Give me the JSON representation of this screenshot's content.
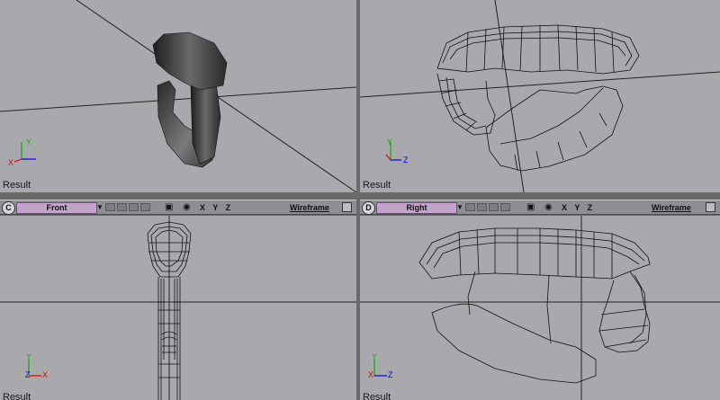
{
  "viewports": {
    "top_left": {
      "label": "Result"
    },
    "top_right": {
      "label": "Result"
    },
    "bottom_left": {
      "badge": "C",
      "view": "Front",
      "axes": "X Y Z",
      "mode": "Wireframe",
      "label": "Result"
    },
    "bottom_right": {
      "badge": "D",
      "view": "Right",
      "axes": "X Y Z",
      "mode": "Wireframe",
      "label": "Result"
    }
  },
  "gizmo": {
    "x_label": "X",
    "y_label": "Y",
    "z_label": "Z",
    "x_color": "#e00000",
    "y_color": "#00b000",
    "z_color": "#0000e0"
  },
  "toolbar_icons": [
    "dropdown-arrow-icon",
    "camera-icon",
    "eye-icon",
    "maximize-icon"
  ]
}
